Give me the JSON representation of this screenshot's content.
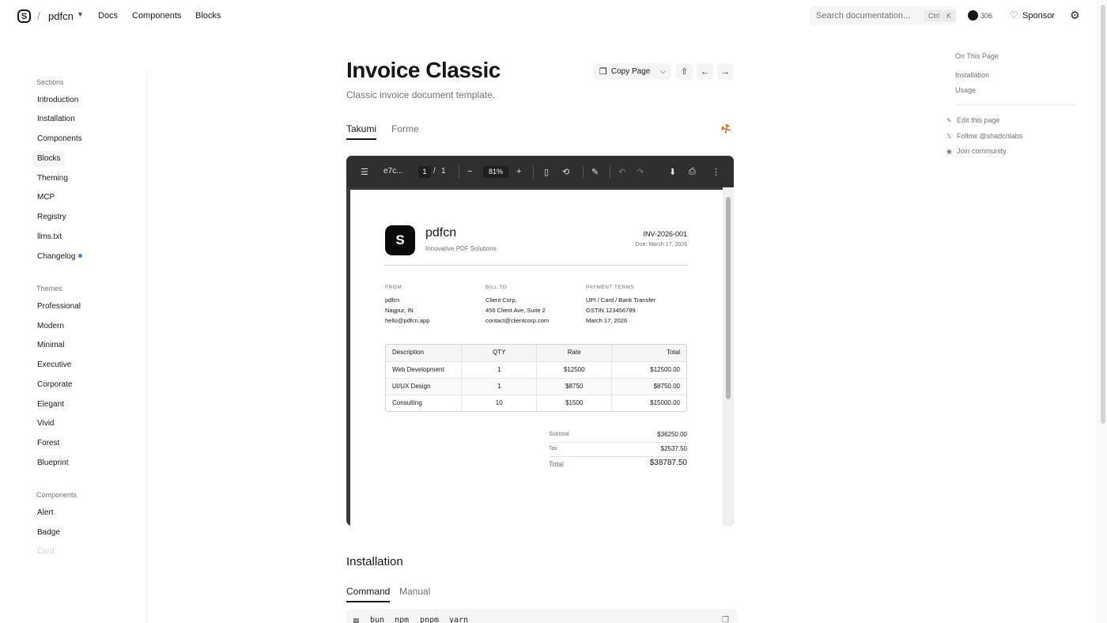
{
  "header": {
    "logo_glyph": "S",
    "brand": "pdfcn",
    "nav": [
      "Docs",
      "Components",
      "Blocks"
    ],
    "search_placeholder": "Search documentation...",
    "kbd_ctrl": "Ctrl",
    "kbd_k": "K",
    "github_count": "306",
    "sponsor": "Sponsor"
  },
  "sidebar": {
    "sections_heading": "Sections",
    "sections": [
      "Introduction",
      "Installation",
      "Components",
      "Blocks",
      "Theming",
      "MCP",
      "Registry",
      "llms.txt",
      "Changelog"
    ],
    "active": "Blocks",
    "themes_heading": "Themes",
    "themes": [
      "Professional",
      "Modern",
      "Minimal",
      "Executive",
      "Corporate",
      "Elegant",
      "Vivid",
      "Forest",
      "Blueprint"
    ],
    "components_heading": "Components",
    "components": [
      "Alert",
      "Badge",
      "Card"
    ]
  },
  "main": {
    "title": "Invoice Classic",
    "description": "Classic invoice document template.",
    "copy_page": "Copy Page",
    "tabs": [
      "Takumi",
      "Forme"
    ],
    "viewer": {
      "filename": "e7c...",
      "page_current": "1",
      "page_sep": "/",
      "page_total": "1",
      "zoom": "81%"
    },
    "invoice": {
      "logo_glyph": "S",
      "brand": "pdfcn",
      "tagline": "Innovative PDF Solutions",
      "number": "INV-2026-001",
      "due": "Due: March 17, 2026",
      "from_label": "FROM",
      "from": [
        "pdfcn",
        "Nagpur, IN",
        "hello@pdfcn.app"
      ],
      "bill_label": "BILL TO",
      "bill": [
        "Client Corp.",
        "456 Client Ave, Suite 2",
        "contact@clientcorp.com"
      ],
      "terms_label": "PAYMENT TERMS",
      "terms": [
        "UPI / Card / Bank Transfer",
        "GSTIN 123456789",
        "March 17, 2026"
      ],
      "columns": [
        "Description",
        "QTY",
        "Rate",
        "Total"
      ],
      "rows": [
        [
          "Web Development",
          "1",
          "$12500",
          "$12500.00"
        ],
        [
          "UI/UX Design",
          "1",
          "$8750",
          "$8750.00"
        ],
        [
          "Consulting",
          "10",
          "$1500",
          "$15000.00"
        ]
      ],
      "subtotal_label": "Subtotal",
      "subtotal": "$36250.00",
      "tax_label": "Tax",
      "tax": "$2537.50",
      "total_label": "Total",
      "total": "$38787.50"
    },
    "installation_title": "Installation",
    "install_tabs": [
      "Command",
      "Manual"
    ],
    "package_managers": [
      "bun",
      "npm",
      "pnpm",
      "yarn"
    ]
  },
  "rail": {
    "heading": "On This Page",
    "links": [
      "Installation",
      "Usage"
    ],
    "actions": [
      "Edit this page",
      "Follow @shadcnlabs",
      "Join community"
    ]
  }
}
